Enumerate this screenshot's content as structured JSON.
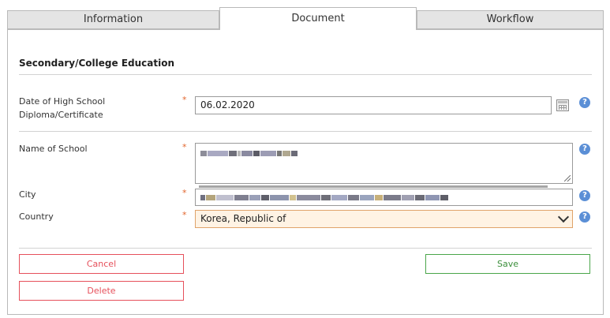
{
  "tabs": {
    "information": "Information",
    "document": "Document",
    "workflow": "Workflow"
  },
  "section": {
    "title": "Secondary/College Education"
  },
  "fields": {
    "diploma_date": {
      "label": "Date of High School Diploma/Certificate",
      "value": "06.02.2020"
    },
    "school_name": {
      "label": "Name of School"
    },
    "city": {
      "label": "City"
    },
    "country": {
      "label": "Country",
      "value": "Korea, Republic of"
    }
  },
  "required_mark": "*",
  "help_glyph": "?",
  "buttons": {
    "cancel": "Cancel",
    "save": "Save",
    "delete": "Delete"
  },
  "colors": {
    "required": "#e2652c",
    "help": "#5b8fd6",
    "danger": "#e6505b",
    "success": "#4aa64a",
    "select_bg": "#fff3e4"
  }
}
